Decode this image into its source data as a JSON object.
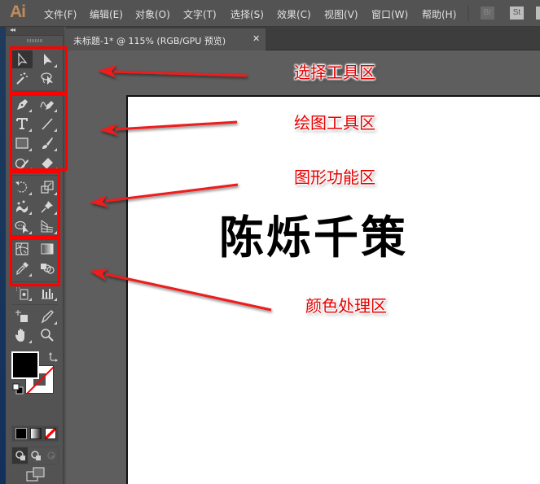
{
  "app": {
    "logo": "Ai",
    "menu": [
      {
        "id": "file",
        "label": "文件(F)"
      },
      {
        "id": "edit",
        "label": "编辑(E)"
      },
      {
        "id": "object",
        "label": "对象(O)"
      },
      {
        "id": "type",
        "label": "文字(T)"
      },
      {
        "id": "select",
        "label": "选择(S)"
      },
      {
        "id": "effect",
        "label": "效果(C)"
      },
      {
        "id": "view",
        "label": "视图(V)"
      },
      {
        "id": "window",
        "label": "窗口(W)"
      },
      {
        "id": "help",
        "label": "帮助(H)"
      }
    ],
    "bridge_label": "Br",
    "stock_label": "St"
  },
  "toolbar": {
    "collapse_glyph": "◂◂",
    "tools": [
      {
        "name": "selection-tool",
        "icon": "arrow-outline-icon",
        "active": true
      },
      {
        "name": "direct-selection-tool",
        "icon": "arrow-filled-icon"
      },
      {
        "name": "magic-wand-tool",
        "icon": "magic-wand-icon"
      },
      {
        "name": "lasso-tool",
        "icon": "lasso-icon"
      },
      {
        "name": "pen-tool",
        "icon": "pen-icon"
      },
      {
        "name": "curvature-tool",
        "icon": "curvature-pen-icon"
      },
      {
        "name": "type-tool",
        "icon": "type-icon",
        "glyph": "T"
      },
      {
        "name": "line-segment-tool",
        "icon": "line-icon"
      },
      {
        "name": "rectangle-tool",
        "icon": "rectangle-icon"
      },
      {
        "name": "paintbrush-tool",
        "icon": "paintbrush-icon"
      },
      {
        "name": "shaper-tool",
        "icon": "shaper-icon"
      },
      {
        "name": "eraser-tool",
        "icon": "eraser-icon"
      },
      {
        "name": "rotate-tool",
        "icon": "rotate-icon"
      },
      {
        "name": "scale-tool",
        "icon": "scale-icon"
      },
      {
        "name": "puppet-warp-tool",
        "icon": "puppet-warp-icon"
      },
      {
        "name": "pin-tool",
        "icon": "pin-icon"
      },
      {
        "name": "shape-builder-tool",
        "icon": "shape-builder-icon"
      },
      {
        "name": "perspective-grid-tool",
        "icon": "perspective-grid-icon"
      },
      {
        "name": "mesh-tool",
        "icon": "mesh-icon"
      },
      {
        "name": "gradient-tool",
        "icon": "gradient-icon"
      },
      {
        "name": "eyedropper-tool",
        "icon": "eyedropper-icon"
      },
      {
        "name": "blend-tool",
        "icon": "blend-icon"
      },
      {
        "name": "symbol-sprayer-tool",
        "icon": "symbol-sprayer-icon"
      },
      {
        "name": "column-graph-tool",
        "icon": "column-graph-icon"
      },
      {
        "name": "artboard-tool",
        "icon": "artboard-icon"
      },
      {
        "name": "slice-tool",
        "icon": "slice-icon"
      },
      {
        "name": "hand-tool",
        "icon": "hand-icon"
      },
      {
        "name": "zoom-tool",
        "icon": "zoom-icon"
      }
    ],
    "fill_color": "#000000",
    "stroke_color": "none",
    "color_modes": [
      "color",
      "gradient",
      "none"
    ],
    "draw_modes": [
      "draw-normal",
      "draw-behind",
      "draw-inside"
    ]
  },
  "document": {
    "tab_title": "未标题-1* @ 115% (RGB/GPU 预览)",
    "close_glyph": "✕",
    "artboard_text": "陈烁千策"
  },
  "annotations": {
    "color": "#ff0000",
    "labels": [
      {
        "id": "selection",
        "text": "选择工具区"
      },
      {
        "id": "drawing",
        "text": "绘图工具区"
      },
      {
        "id": "transform",
        "text": "图形功能区"
      },
      {
        "id": "color",
        "text": "颜色处理区"
      }
    ]
  }
}
